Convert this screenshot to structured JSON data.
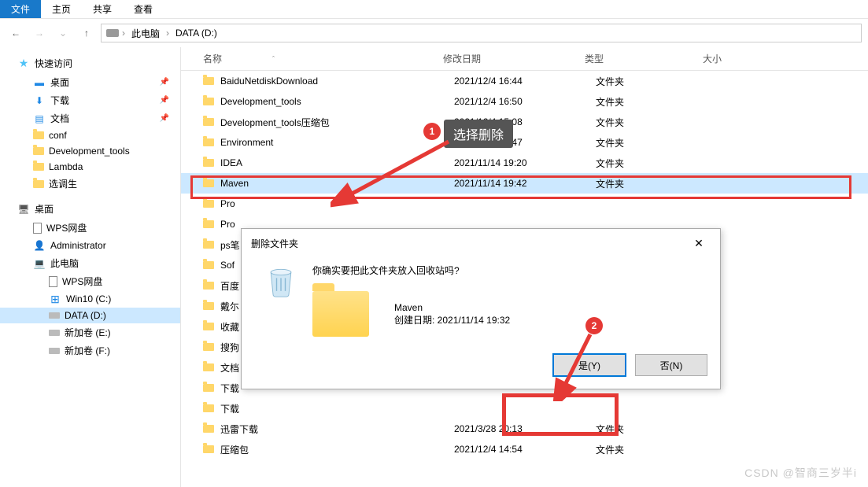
{
  "menu": {
    "file": "文件",
    "home": "主页",
    "share": "共享",
    "view": "查看"
  },
  "breadcrumb": {
    "pc": "此电脑",
    "drive": "DATA (D:)"
  },
  "headers": {
    "name": "名称",
    "date": "修改日期",
    "type": "类型",
    "size": "大小"
  },
  "sidebar": {
    "quick": "快速访问",
    "quick_items": [
      "桌面",
      "下载",
      "文档",
      "conf",
      "Development_tools",
      "Lambda",
      "选调生"
    ],
    "desktop": "桌面",
    "desktop_items": [
      "WPS网盘",
      "Administrator",
      "此电脑"
    ],
    "pc_items": [
      "WPS网盘",
      "Win10 (C:)",
      "DATA (D:)",
      "新加卷 (E:)",
      "新加卷 (F:)"
    ]
  },
  "files": [
    {
      "name": "BaiduNetdiskDownload",
      "date": "2021/12/4 16:44",
      "type": "文件夹"
    },
    {
      "name": "Development_tools",
      "date": "2021/12/4 16:50",
      "type": "文件夹"
    },
    {
      "name": "Development_tools压缩包",
      "date": "2021/12/4 15:08",
      "type": "文件夹"
    },
    {
      "name": "Environment",
      "date": "2021/12/4 17:47",
      "type": "文件夹"
    },
    {
      "name": "IDEA",
      "date": "2021/11/14 19:20",
      "type": "文件夹"
    },
    {
      "name": "Maven",
      "date": "2021/11/14 19:42",
      "type": "文件夹"
    },
    {
      "name": "Pro",
      "date": "",
      "type": ""
    },
    {
      "name": "Pro",
      "date": "",
      "type": ""
    },
    {
      "name": "ps笔",
      "date": "",
      "type": ""
    },
    {
      "name": "Sof",
      "date": "",
      "type": ""
    },
    {
      "name": "百度",
      "date": "",
      "type": ""
    },
    {
      "name": "戴尓",
      "date": "",
      "type": ""
    },
    {
      "name": "收藏",
      "date": "",
      "type": ""
    },
    {
      "name": "搜狗",
      "date": "",
      "type": ""
    },
    {
      "name": "文档",
      "date": "",
      "type": ""
    },
    {
      "name": "下载",
      "date": "",
      "type": ""
    },
    {
      "name": "下载",
      "date": "",
      "type": ""
    },
    {
      "name": "迅雷下载",
      "date": "2021/3/28 20:13",
      "type": "文件夹"
    },
    {
      "name": "压缩包",
      "date": "2021/12/4 14:54",
      "type": "文件夹"
    }
  ],
  "callout": "选择删除",
  "steps": {
    "one": "1",
    "two": "2"
  },
  "dialog": {
    "title": "删除文件夹",
    "question": "你确实要把此文件夹放入回收站吗?",
    "item": "Maven",
    "created_label": "创建日期: 2021/11/14 19:32",
    "yes": "是(Y)",
    "no": "否(N)"
  },
  "watermark": "CSDN @智商三岁半i"
}
